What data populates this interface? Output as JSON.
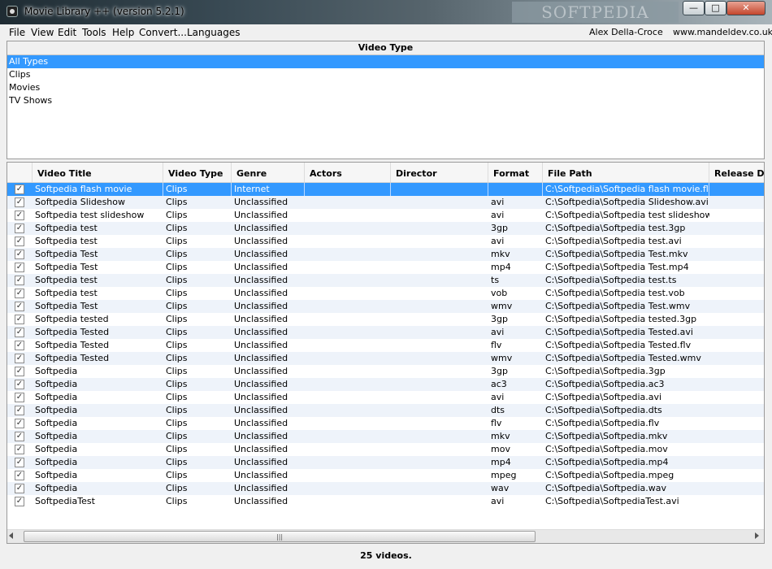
{
  "window": {
    "title": "Movie Library ++ (version 5.2.1)",
    "watermark": "SOFTPEDIA",
    "controls": {
      "minimize": "—",
      "maximize": "□",
      "close": "✕"
    }
  },
  "menu": {
    "items": [
      "File",
      "View",
      "Edit",
      "Tools",
      "Help",
      "Convert...",
      "Languages"
    ],
    "user": "Alex Della-Croce",
    "website": "www.mandeldev.co.uk"
  },
  "video_type": {
    "header": "Video Type",
    "items": [
      "All Types",
      "Clips",
      "Movies",
      "TV Shows"
    ],
    "selected": "All Types"
  },
  "table": {
    "columns": [
      "Video Title",
      "Video Type",
      "Genre",
      "Actors",
      "Director",
      "Format",
      "File Path",
      "Release Date"
    ],
    "rows": [
      [
        "Softpedia flash movie",
        "Clips",
        "Internet",
        "",
        "",
        "",
        "C:\\Softpedia\\Softpedia flash movie.flv"
      ],
      [
        "Softpedia Slideshow",
        "Clips",
        "Unclassified",
        "",
        "",
        "avi",
        "C:\\Softpedia\\Softpedia Slideshow.avi"
      ],
      [
        "Softpedia test slideshow",
        "Clips",
        "Unclassified",
        "",
        "",
        "avi",
        "C:\\Softpedia\\Softpedia test slideshow.avi"
      ],
      [
        "Softpedia test",
        "Clips",
        "Unclassified",
        "",
        "",
        "3gp",
        "C:\\Softpedia\\Softpedia test.3gp"
      ],
      [
        "Softpedia test",
        "Clips",
        "Unclassified",
        "",
        "",
        "avi",
        "C:\\Softpedia\\Softpedia test.avi"
      ],
      [
        "Softpedia Test",
        "Clips",
        "Unclassified",
        "",
        "",
        "mkv",
        "C:\\Softpedia\\Softpedia Test.mkv"
      ],
      [
        "Softpedia Test",
        "Clips",
        "Unclassified",
        "",
        "",
        "mp4",
        "C:\\Softpedia\\Softpedia Test.mp4"
      ],
      [
        "Softpedia test",
        "Clips",
        "Unclassified",
        "",
        "",
        "ts",
        "C:\\Softpedia\\Softpedia test.ts"
      ],
      [
        "Softpedia test",
        "Clips",
        "Unclassified",
        "",
        "",
        "vob",
        "C:\\Softpedia\\Softpedia test.vob"
      ],
      [
        "Softpedia Test",
        "Clips",
        "Unclassified",
        "",
        "",
        "wmv",
        "C:\\Softpedia\\Softpedia Test.wmv"
      ],
      [
        "Softpedia tested",
        "Clips",
        "Unclassified",
        "",
        "",
        "3gp",
        "C:\\Softpedia\\Softpedia tested.3gp"
      ],
      [
        "Softpedia Tested",
        "Clips",
        "Unclassified",
        "",
        "",
        "avi",
        "C:\\Softpedia\\Softpedia Tested.avi"
      ],
      [
        "Softpedia Tested",
        "Clips",
        "Unclassified",
        "",
        "",
        "flv",
        "C:\\Softpedia\\Softpedia Tested.flv"
      ],
      [
        "Softpedia Tested",
        "Clips",
        "Unclassified",
        "",
        "",
        "wmv",
        "C:\\Softpedia\\Softpedia Tested.wmv"
      ],
      [
        "Softpedia",
        "Clips",
        "Unclassified",
        "",
        "",
        "3gp",
        "C:\\Softpedia\\Softpedia.3gp"
      ],
      [
        "Softpedia",
        "Clips",
        "Unclassified",
        "",
        "",
        "ac3",
        "C:\\Softpedia\\Softpedia.ac3"
      ],
      [
        "Softpedia",
        "Clips",
        "Unclassified",
        "",
        "",
        "avi",
        "C:\\Softpedia\\Softpedia.avi"
      ],
      [
        "Softpedia",
        "Clips",
        "Unclassified",
        "",
        "",
        "dts",
        "C:\\Softpedia\\Softpedia.dts"
      ],
      [
        "Softpedia",
        "Clips",
        "Unclassified",
        "",
        "",
        "flv",
        "C:\\Softpedia\\Softpedia.flv"
      ],
      [
        "Softpedia",
        "Clips",
        "Unclassified",
        "",
        "",
        "mkv",
        "C:\\Softpedia\\Softpedia.mkv"
      ],
      [
        "Softpedia",
        "Clips",
        "Unclassified",
        "",
        "",
        "mov",
        "C:\\Softpedia\\Softpedia.mov"
      ],
      [
        "Softpedia",
        "Clips",
        "Unclassified",
        "",
        "",
        "mp4",
        "C:\\Softpedia\\Softpedia.mp4"
      ],
      [
        "Softpedia",
        "Clips",
        "Unclassified",
        "",
        "",
        "mpeg",
        "C:\\Softpedia\\Softpedia.mpeg"
      ],
      [
        "Softpedia",
        "Clips",
        "Unclassified",
        "",
        "",
        "wav",
        "C:\\Softpedia\\Softpedia.wav"
      ],
      [
        "SoftpediaTest",
        "Clips",
        "Unclassified",
        "",
        "",
        "avi",
        "C:\\Softpedia\\SoftpediaTest.avi"
      ]
    ],
    "selected_row": 0
  },
  "status": {
    "text": "25 videos."
  },
  "colors": {
    "selection": "#3399ff",
    "alt_row": "#eef3fa"
  }
}
